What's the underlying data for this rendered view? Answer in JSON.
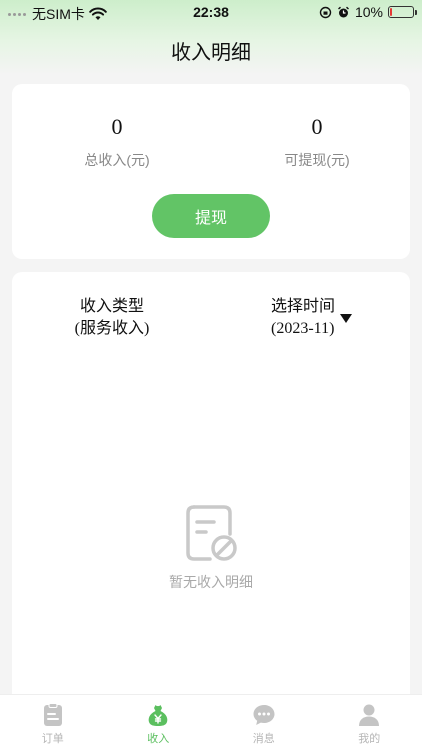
{
  "status_bar": {
    "carrier": "无SIM卡",
    "time": "22:38",
    "battery": "10%",
    "battery_level": 0.1
  },
  "header": {
    "title": "收入明细"
  },
  "summary": {
    "total_income_value": "0",
    "total_income_label": "总收入(元)",
    "withdrawable_value": "0",
    "withdrawable_label": "可提现(元)",
    "withdraw_button": "提现"
  },
  "filters": {
    "type_label": "收入类型",
    "type_value": "(服务收入)",
    "time_label": "选择时间",
    "time_value": "(2023-11)"
  },
  "empty_state": {
    "text": "暂无收入明细",
    "icon": "no-records-icon"
  },
  "tabbar": {
    "items": [
      {
        "label": "订单",
        "icon": "clipboard-icon",
        "active": false
      },
      {
        "label": "收入",
        "icon": "money-bag-icon",
        "active": true
      },
      {
        "label": "消息",
        "icon": "chat-bubble-icon",
        "active": false
      },
      {
        "label": "我的",
        "icon": "person-icon",
        "active": false
      }
    ]
  },
  "colors": {
    "accent": "#62c466",
    "muted": "#b5b5b5",
    "battery_low": "#e53935"
  }
}
